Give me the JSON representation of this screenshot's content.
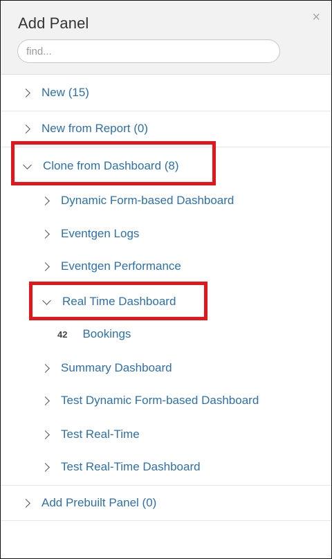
{
  "header": {
    "title": "Add Panel",
    "close_glyph": "×"
  },
  "search": {
    "placeholder": "find..."
  },
  "top_items": [
    {
      "label": "New (15)"
    },
    {
      "label": "New from Report (0)"
    },
    {
      "label": "Clone from Dashboard (8)"
    }
  ],
  "dashboards": [
    {
      "label": "Dynamic Form-based Dashboard"
    },
    {
      "label": "Eventgen Logs"
    },
    {
      "label": "Eventgen Performance"
    },
    {
      "label": "Real Time Dashboard"
    },
    {
      "label": "Summary Dashboard"
    },
    {
      "label": "Test Dynamic Form-based Dashboard"
    },
    {
      "label": "Test Real-Time"
    },
    {
      "label": "Test Real-Time Dashboard"
    }
  ],
  "panel_item": {
    "badge": "42",
    "label": "Bookings"
  },
  "bottom_items": [
    {
      "label": "Add Prebuilt Panel (0)"
    }
  ],
  "colors": {
    "link": "#2f6fa6",
    "highlight": "#e3161c",
    "header_bg": "#f2f2f2"
  }
}
